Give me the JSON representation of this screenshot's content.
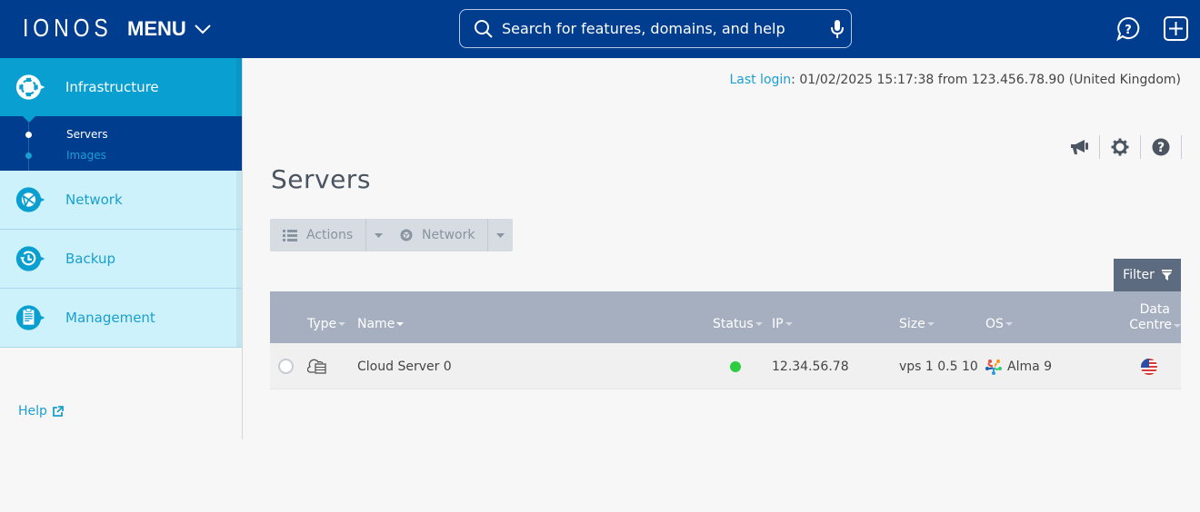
{
  "topbar": {
    "logo": "IONOS",
    "menu_label": "MENU",
    "search_placeholder": "Search for features, domains, and help",
    "icons": [
      "chat-help-icon",
      "add-square-icon"
    ]
  },
  "sidebar": {
    "sections": [
      {
        "label": "Infrastructure",
        "icon": "infrastructure-icon",
        "active": true,
        "sub_items": [
          {
            "label": "Servers",
            "active": true
          },
          {
            "label": "Images",
            "active": false
          }
        ]
      },
      {
        "label": "Network",
        "icon": "network-globe-icon",
        "active": false
      },
      {
        "label": "Backup",
        "icon": "backup-clock-icon",
        "active": false
      },
      {
        "label": "Management",
        "icon": "clipboard-icon",
        "active": false
      }
    ],
    "help_label": "Help"
  },
  "main": {
    "last_login_label": "Last login",
    "last_login_value": ": 01/02/2025 15:17:38 from 123.456.78.90 (United Kingdom)",
    "tool_icons": [
      "megaphone-icon",
      "gear-icon",
      "help-circle-icon"
    ],
    "page_title": "Servers",
    "actions_label": "Actions",
    "network_label": "Network",
    "filter_label": "Filter",
    "table": {
      "columns": {
        "type": "Type",
        "name": "Name",
        "status": "Status",
        "ip": "IP",
        "size": "Size",
        "os": "OS",
        "dc_line1": "Data",
        "dc_line2": "Centre"
      },
      "rows": [
        {
          "type": "cloud-server",
          "name": "Cloud Server 0",
          "status": "running",
          "ip": "12.34.56.78",
          "size": "vps 1 0.5 10",
          "os": "Alma 9",
          "data_centre": "us-flag"
        }
      ]
    }
  },
  "colors": {
    "topbar": "#003d8f",
    "accent": "#0a9fd1",
    "link": "#1a9fd0",
    "status_ok": "#2ecc40",
    "table_header": "#a6afbf",
    "filter_btn": "#5d6b80"
  }
}
